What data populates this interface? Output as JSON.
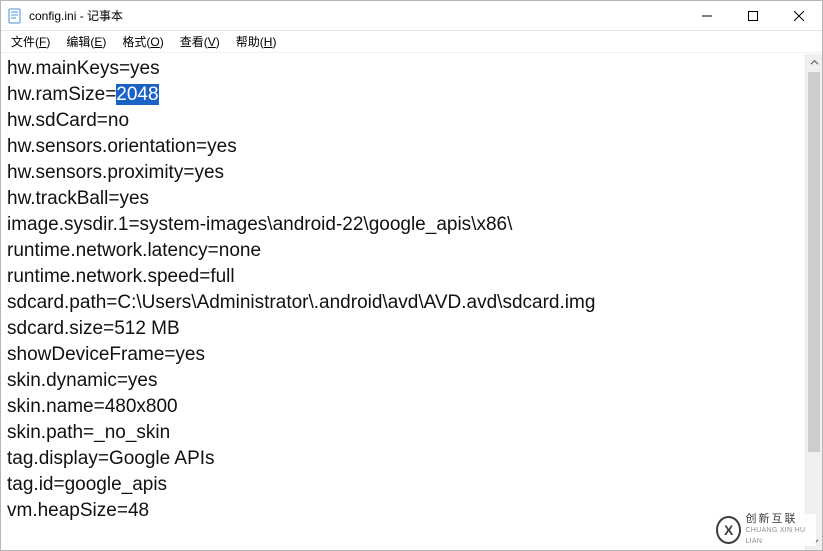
{
  "window": {
    "title": "config.ini - 记事本"
  },
  "menu": {
    "file": {
      "label": "文件",
      "accel": "F"
    },
    "edit": {
      "label": "编辑",
      "accel": "E"
    },
    "format": {
      "label": "格式",
      "accel": "O"
    },
    "view": {
      "label": "查看",
      "accel": "V"
    },
    "help": {
      "label": "帮助",
      "accel": "H"
    }
  },
  "content": {
    "lines": [
      {
        "key": "hw.mainKeys",
        "value": "yes"
      },
      {
        "key": "hw.ramSize",
        "value": "2048",
        "value_selected": true
      },
      {
        "key": "hw.sdCard",
        "value": "no"
      },
      {
        "key": "hw.sensors.orientation",
        "value": "yes"
      },
      {
        "key": "hw.sensors.proximity",
        "value": "yes"
      },
      {
        "key": "hw.trackBall",
        "value": "yes"
      },
      {
        "key": "image.sysdir.1",
        "value": "system-images\\android-22\\google_apis\\x86\\"
      },
      {
        "key": "runtime.network.latency",
        "value": "none"
      },
      {
        "key": "runtime.network.speed",
        "value": "full"
      },
      {
        "key": "sdcard.path",
        "value": "C:\\Users\\Administrator\\.android\\avd\\AVD.avd\\sdcard.img"
      },
      {
        "key": "sdcard.size",
        "value": "512 MB"
      },
      {
        "key": "showDeviceFrame",
        "value": "yes"
      },
      {
        "key": "skin.dynamic",
        "value": "yes"
      },
      {
        "key": "skin.name",
        "value": "480x800"
      },
      {
        "key": "skin.path",
        "value": "_no_skin"
      },
      {
        "key": "tag.display",
        "value": "Google APIs"
      },
      {
        "key": "tag.id",
        "value": "google_apis"
      },
      {
        "key": "vm.heapSize",
        "value": "48"
      }
    ]
  },
  "watermark": {
    "mark": "X",
    "cn": "创新互联",
    "en": "CHUANG XIN HU LIAN"
  }
}
